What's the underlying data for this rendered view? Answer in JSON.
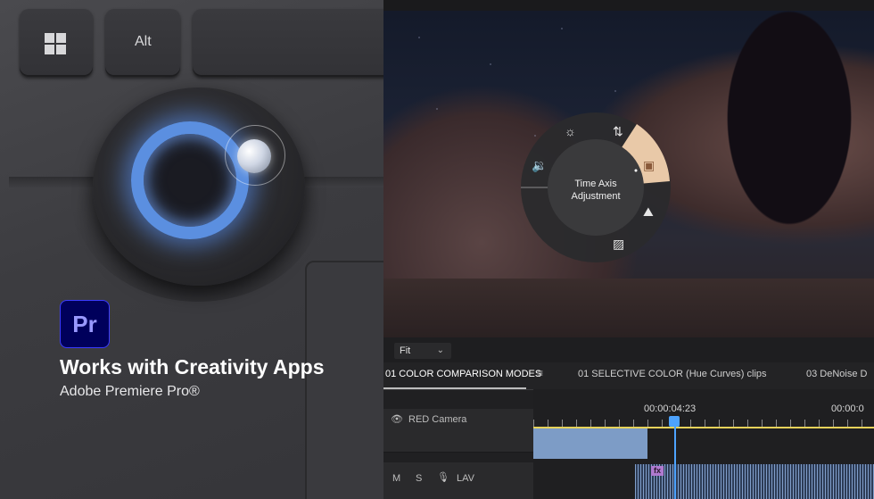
{
  "keyboard": {
    "alt_key_label": "Alt"
  },
  "branding": {
    "app_logo_text": "Pr",
    "headline": "Works with Creativity Apps",
    "subline": "Adobe Premiere Pro®"
  },
  "radial_menu": {
    "center_line1": "Time Axis",
    "center_line2": "Adjustment",
    "accent_color": "#e9c9a8"
  },
  "monitor": {
    "zoom_label": "Fit"
  },
  "tabs": [
    {
      "label": "01 COLOR COMPARISON MODES",
      "active": true
    },
    {
      "label": "01 SELECTIVE COLOR (Hue Curves) clips",
      "active": false
    },
    {
      "label": "03 DeNoise D",
      "active": false
    }
  ],
  "timeline": {
    "current_time": "00:00:04:23",
    "next_time": "00:00:0",
    "video_track": "RED Camera",
    "audio_track": {
      "mute": "M",
      "solo": "S",
      "name": "LAV"
    }
  }
}
